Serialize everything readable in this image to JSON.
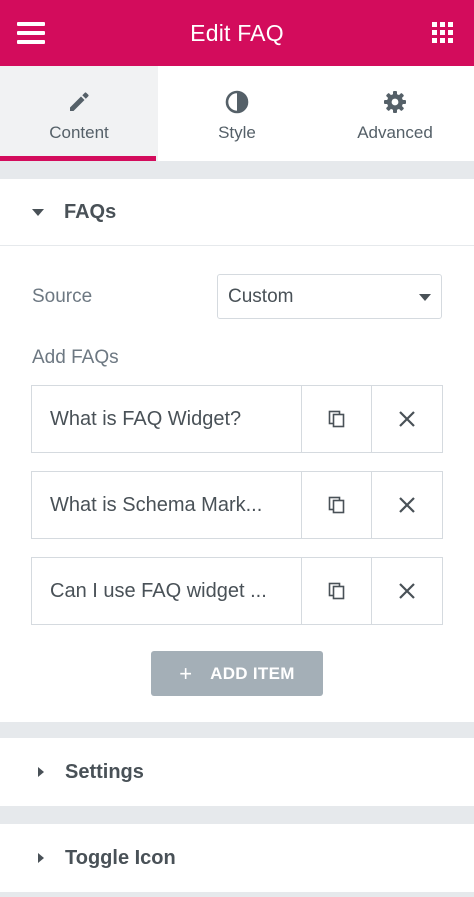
{
  "header": {
    "title": "Edit FAQ"
  },
  "tabs": [
    {
      "label": "Content",
      "icon": "pencil-icon",
      "active": true
    },
    {
      "label": "Style",
      "icon": "contrast-icon",
      "active": false
    },
    {
      "label": "Advanced",
      "icon": "gear-icon",
      "active": false
    }
  ],
  "faqs_section": {
    "title": "FAQs",
    "source_label": "Source",
    "source_value": "Custom",
    "add_faqs_label": "Add FAQs",
    "items": [
      {
        "title": "What is FAQ Widget?"
      },
      {
        "title": "What is Schema Mark..."
      },
      {
        "title": "Can I use FAQ widget ..."
      }
    ],
    "add_item_label": "ADD ITEM"
  },
  "settings_section": {
    "title": "Settings"
  },
  "toggle_icon_section": {
    "title": "Toggle Icon"
  },
  "colors": {
    "brand": "#d30c5c",
    "button_gray": "#a4afb7",
    "text": "#495157"
  }
}
